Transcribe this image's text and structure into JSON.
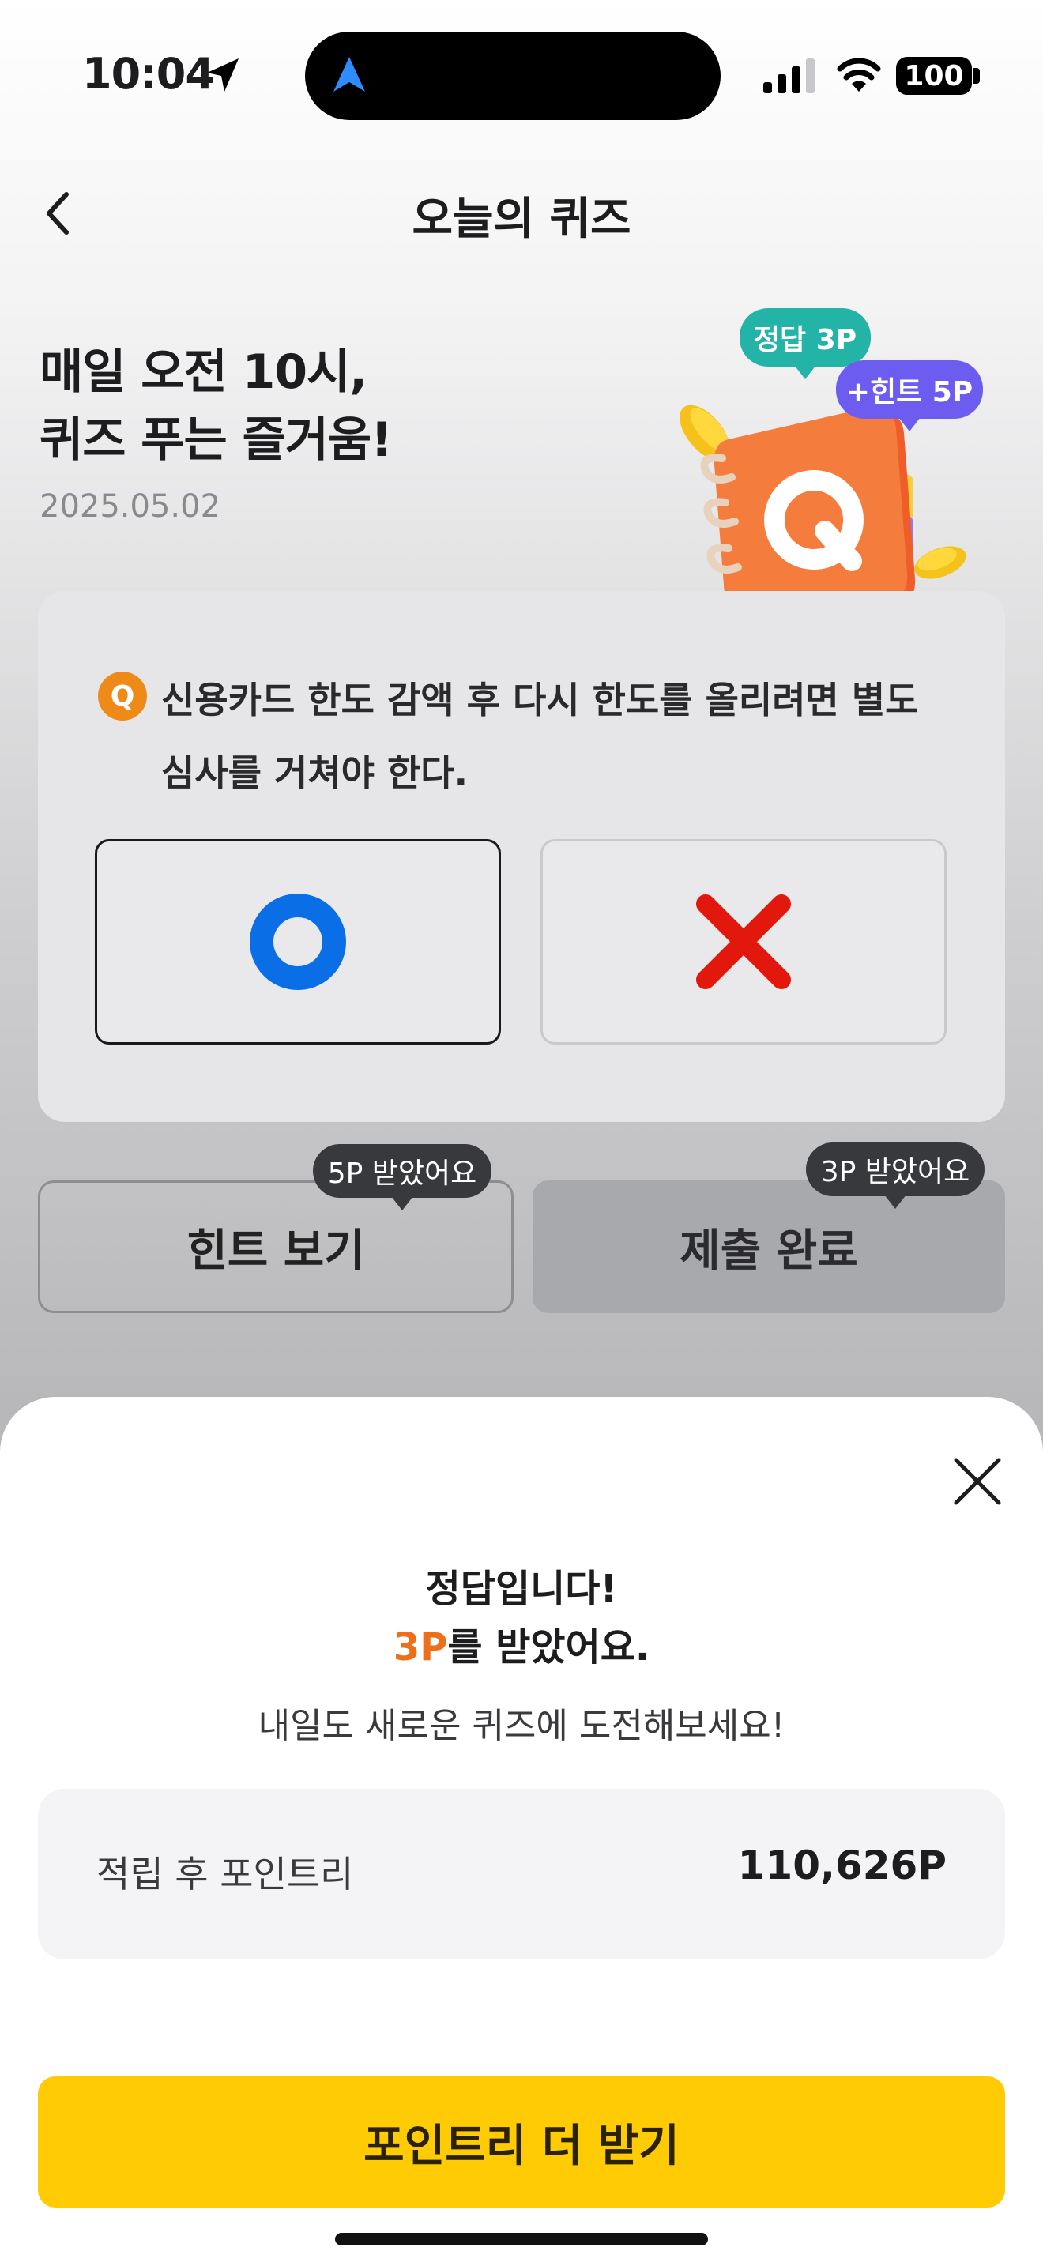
{
  "status_bar": {
    "time": "10:04",
    "battery": "100"
  },
  "nav": {
    "title": "오늘의 퀴즈"
  },
  "hero": {
    "headline_line1": "매일 오전 10시,",
    "headline_line2": "퀴즈 푸는 즐거움!",
    "date": "2025.05.02",
    "bubble_correct": "정답 3P",
    "bubble_hint": "+힌트 5P"
  },
  "quiz": {
    "badge": "Q",
    "question_line1": "신용카드 한도 감액 후 다시 한도를 올리려면 별도",
    "question_line2": "심사를 거쳐야 한다.",
    "options": [
      {
        "value": "O",
        "icon": "circle-o-icon",
        "color": "#0a6fe6",
        "selected": true
      },
      {
        "value": "X",
        "icon": "cross-x-icon",
        "color": "#e3180d",
        "selected": false
      }
    ]
  },
  "actions": {
    "hint_label": "힌트 보기",
    "hint_tag": "5P 받았어요",
    "submit_label": "제출 완료",
    "submit_tag": "3P 받았어요"
  },
  "result_sheet": {
    "title_line1": "정답입니다!",
    "title_points": "3P",
    "title_line2_rest": "를 받았어요.",
    "subtitle": "내일도 새로운 퀴즈에 도전해보세요!",
    "points_label": "적립 후 포인트리",
    "points_value": "110,626P",
    "cta_label": "포인트리 더 받기",
    "accent_color": "#ee6f1a",
    "cta_color": "#ffcb05"
  }
}
